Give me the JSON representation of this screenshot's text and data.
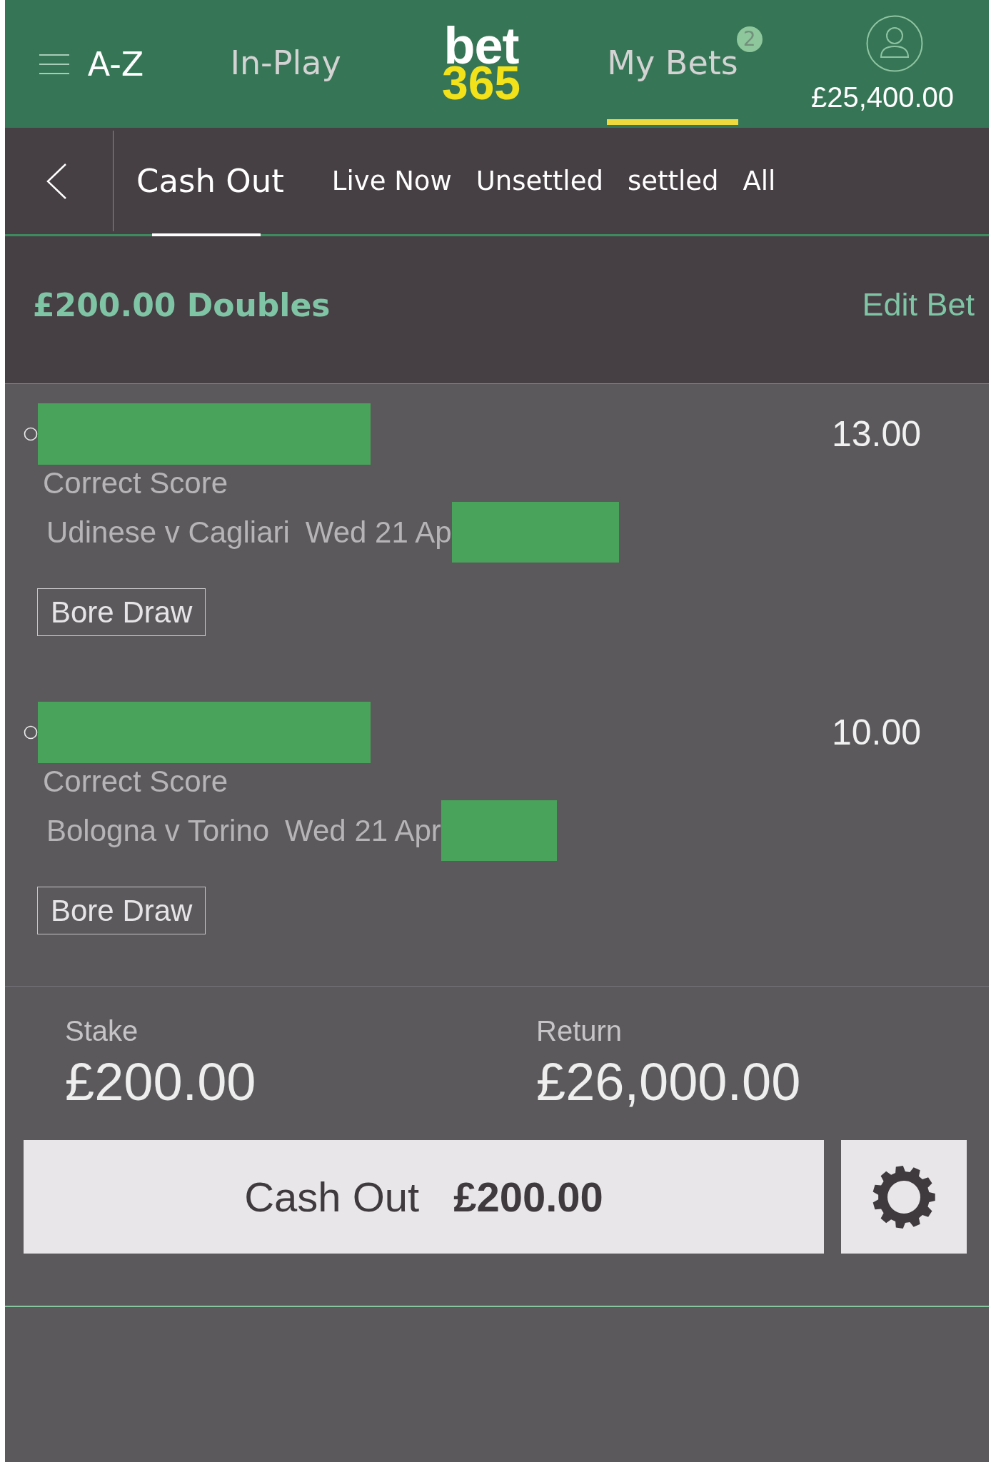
{
  "header": {
    "items": [
      {
        "kind": "menu",
        "label": "A-Z"
      },
      {
        "kind": "tab",
        "label": "In-Play",
        "selected": false
      },
      {
        "kind": "logo",
        "line_1": "bet",
        "line_2": "365"
      },
      {
        "kind": "tab",
        "label": "My Bets",
        "selected": true,
        "badge": "2"
      },
      {
        "kind": "account",
        "balance": "£25,400.00"
      }
    ]
  },
  "filters": {
    "tabs": [
      {
        "label": "Cash Out",
        "selected": true
      },
      {
        "label": "Live Now",
        "selected": false
      },
      {
        "label": "Unsettled",
        "selected": false
      },
      {
        "label": "settled",
        "selected": false
      },
      {
        "label": "All",
        "selected": false
      }
    ]
  },
  "bet": {
    "title": "£200.00 Doubles",
    "edit_label": "Edit Bet",
    "selections": [
      {
        "odds": "13.00",
        "market": "Correct Score",
        "fixture": "Udinese v Cagliari",
        "date": "Wed 21 Ap",
        "tag": "Bore Draw"
      },
      {
        "odds": "10.00",
        "market": "Correct Score",
        "fixture": "Bologna v Torino",
        "date": "Wed 21 Apr",
        "tag": "Bore Draw"
      }
    ],
    "stake": {
      "label": "Stake",
      "value": "£200.00"
    },
    "return": {
      "label": "Return",
      "value": "£26,000.00"
    },
    "cash_out": {
      "label": "Cash Out",
      "amount": "£200.00"
    }
  }
}
